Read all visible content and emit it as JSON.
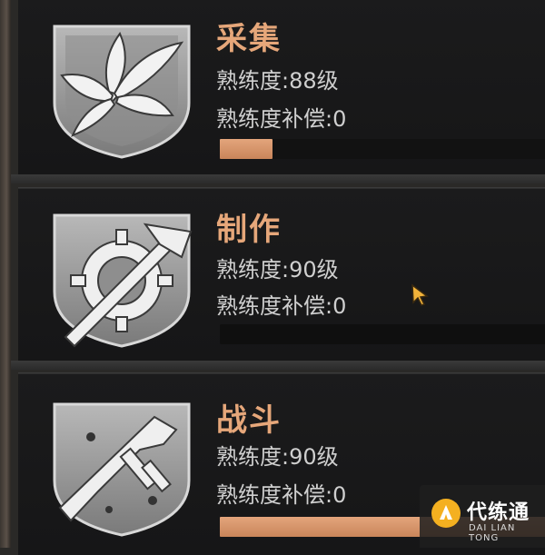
{
  "skills": [
    {
      "title": "采集",
      "proficiency": "熟练度:88级",
      "compensation": "熟练度补偿:0",
      "progress": 0.16,
      "icon": "leaf-bundle-icon"
    },
    {
      "title": "制作",
      "proficiency": "熟练度:90级",
      "compensation": "熟练度补偿:0",
      "progress": 0,
      "icon": "gear-hammer-icon"
    },
    {
      "title": "战斗",
      "proficiency": "熟练度:90级",
      "compensation": "熟练度补偿:0",
      "progress": 1,
      "icon": "smg-icon"
    }
  ],
  "accent_color": "#e6a77a",
  "watermark": {
    "cn": "代练通",
    "en": "DAI LIAN TONG"
  }
}
